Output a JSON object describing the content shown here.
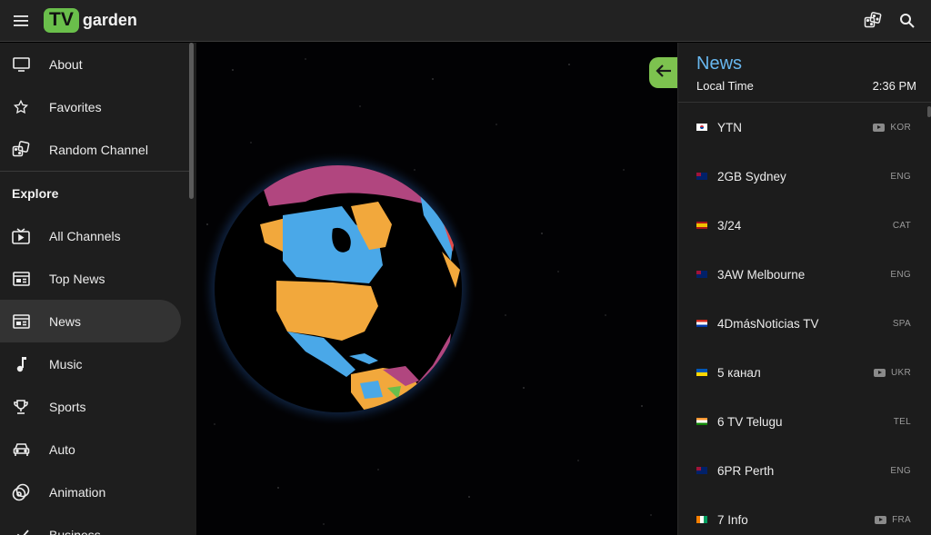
{
  "topbar": {
    "logo_tv": "TV",
    "logo_garden": "garden"
  },
  "sidebar": {
    "items_top": [
      {
        "label": "About",
        "icon": "monitor-icon"
      },
      {
        "label": "Favorites",
        "icon": "star-icon"
      },
      {
        "label": "Random Channel",
        "icon": "dice-icon"
      }
    ],
    "explore_heading": "Explore",
    "items_explore": [
      {
        "label": "All Channels",
        "icon": "tv-play-icon"
      },
      {
        "label": "Top News",
        "icon": "newspaper-icon"
      },
      {
        "label": "News",
        "icon": "newspaper-icon",
        "active": true
      },
      {
        "label": "Music",
        "icon": "music-note-icon"
      },
      {
        "label": "Sports",
        "icon": "trophy-icon"
      },
      {
        "label": "Auto",
        "icon": "car-icon"
      },
      {
        "label": "Animation",
        "icon": "film-reel-icon"
      },
      {
        "label": "Business",
        "icon": "chart-icon"
      }
    ]
  },
  "panel": {
    "title": "News",
    "time_label": "Local Time",
    "time_value": "2:36 PM",
    "channels": [
      {
        "name": "YTN",
        "lang": "KOR",
        "youtube": true,
        "flag": "kr"
      },
      {
        "name": "2GB Sydney",
        "lang": "ENG",
        "youtube": false,
        "flag": "au"
      },
      {
        "name": "3/24",
        "lang": "CAT",
        "youtube": false,
        "flag": "es"
      },
      {
        "name": "3AW Melbourne",
        "lang": "ENG",
        "youtube": false,
        "flag": "au"
      },
      {
        "name": "4DmásNoticias TV",
        "lang": "SPA",
        "youtube": false,
        "flag": "py"
      },
      {
        "name": "5 канал",
        "lang": "UKR",
        "youtube": true,
        "flag": "ua"
      },
      {
        "name": "6 TV Telugu",
        "lang": "TEL",
        "youtube": false,
        "flag": "in"
      },
      {
        "name": "6PR Perth",
        "lang": "ENG",
        "youtube": false,
        "flag": "au"
      },
      {
        "name": "7 Info",
        "lang": "FRA",
        "youtube": true,
        "flag": "ci"
      }
    ]
  },
  "colors": {
    "accent_green": "#7dc24f",
    "logo_green": "#6abf4b",
    "title_blue": "#68b7ef",
    "globe_magenta": "#b1467f",
    "globe_orange": "#f2a83c",
    "globe_blue": "#4aa8e8"
  }
}
